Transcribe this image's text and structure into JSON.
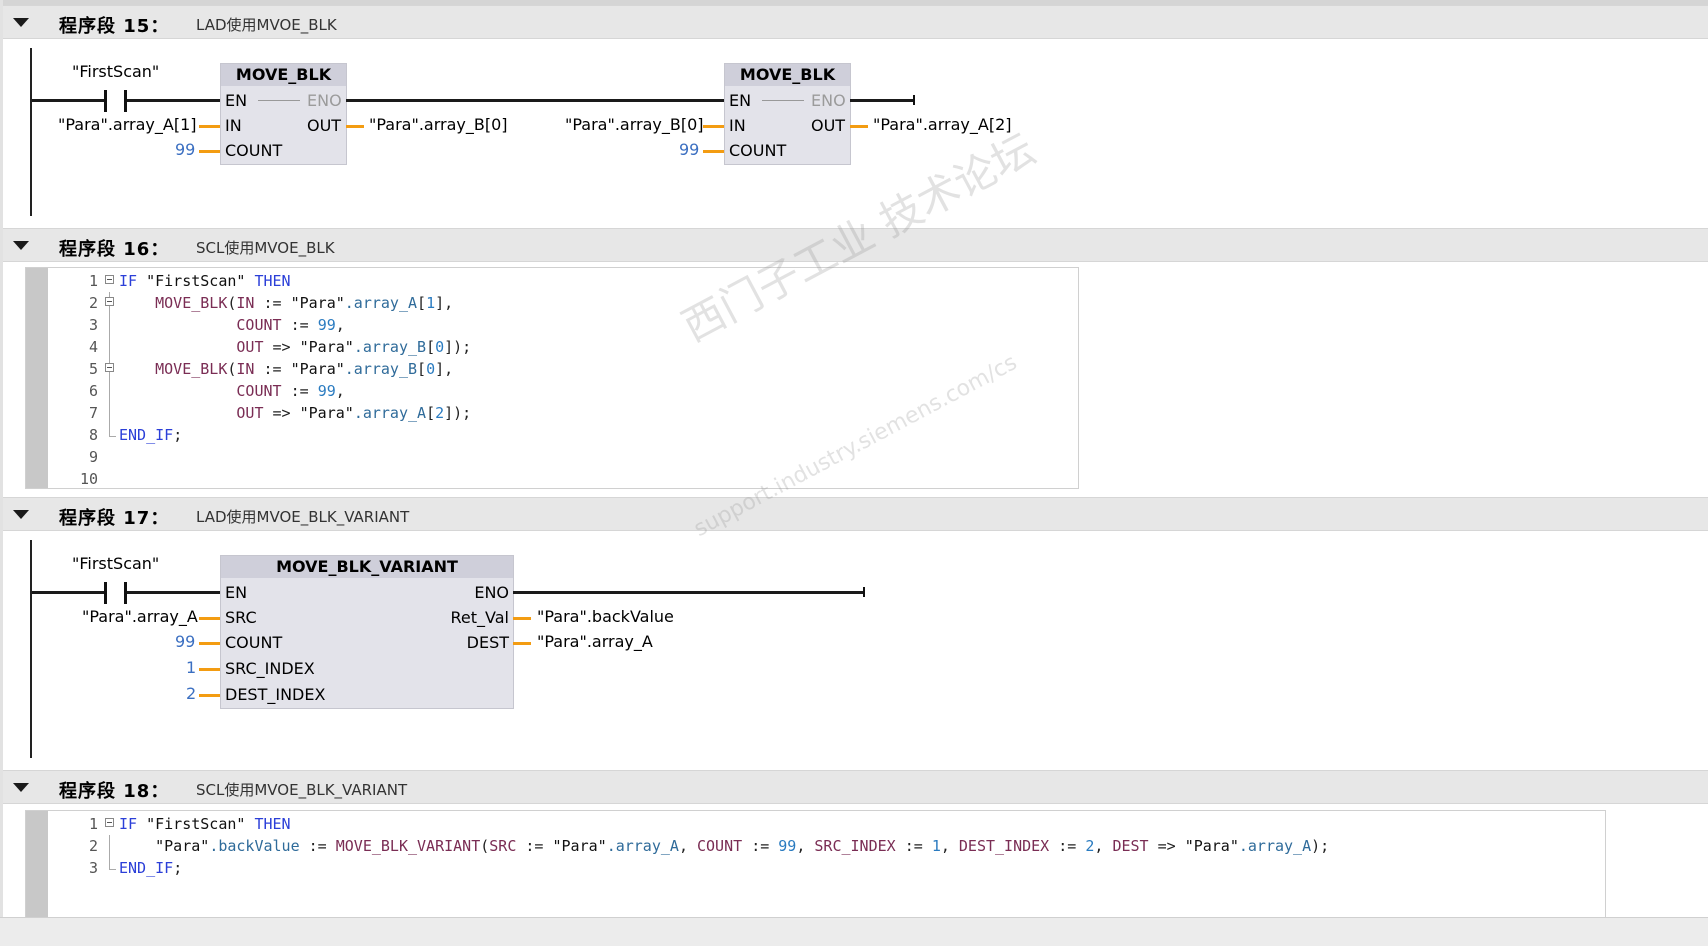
{
  "segments": [
    {
      "title": "程序段 15：",
      "comment": "LAD使用MVOE_BLK"
    },
    {
      "title": "程序段 16：",
      "comment": "SCL使用MVOE_BLK"
    },
    {
      "title": "程序段 17：",
      "comment": "LAD使用MVOE_BLK_VARIANT"
    },
    {
      "title": "程序段 18：",
      "comment": "SCL使用MVOE_BLK_VARIANT"
    }
  ],
  "lad15": {
    "contact_tag": "\"FirstScan\"",
    "block1": {
      "title": "MOVE_BLK",
      "in_arg": "\"Para\".array_A[1]",
      "count_arg": "99",
      "out_arg": "\"Para\".array_B[0]"
    },
    "block2": {
      "title": "MOVE_BLK",
      "in_arg": "\"Para\".array_B[0]",
      "count_arg": "99",
      "out_arg": "\"Para\".array_A[2]"
    },
    "pins": {
      "en": "EN",
      "eno": "ENO",
      "in": "IN",
      "out": "OUT",
      "count": "COUNT"
    }
  },
  "scl16": {
    "line_numbers": [
      "1",
      "2",
      "3",
      "4",
      "5",
      "6",
      "7",
      "8",
      "9",
      "10"
    ]
  },
  "lad17": {
    "contact_tag": "\"FirstScan\"",
    "block": {
      "title": "MOVE_BLK_VARIANT"
    },
    "pins": {
      "en": "EN",
      "eno": "ENO",
      "src": "SRC",
      "count": "COUNT",
      "src_index": "SRC_INDEX",
      "dest_index": "DEST_INDEX",
      "ret_val": "Ret_Val",
      "dest": "DEST"
    },
    "args": {
      "src": "\"Para\".array_A",
      "count": "99",
      "src_index": "1",
      "dest_index": "2",
      "ret_val": "\"Para\".backValue",
      "dest": "\"Para\".array_A"
    }
  },
  "scl18": {
    "line_numbers": [
      "1",
      "2",
      "3"
    ]
  },
  "watermark": {
    "line1": "西门子工业  技术论坛",
    "line2": "support.industry.siemens.com/cs"
  }
}
